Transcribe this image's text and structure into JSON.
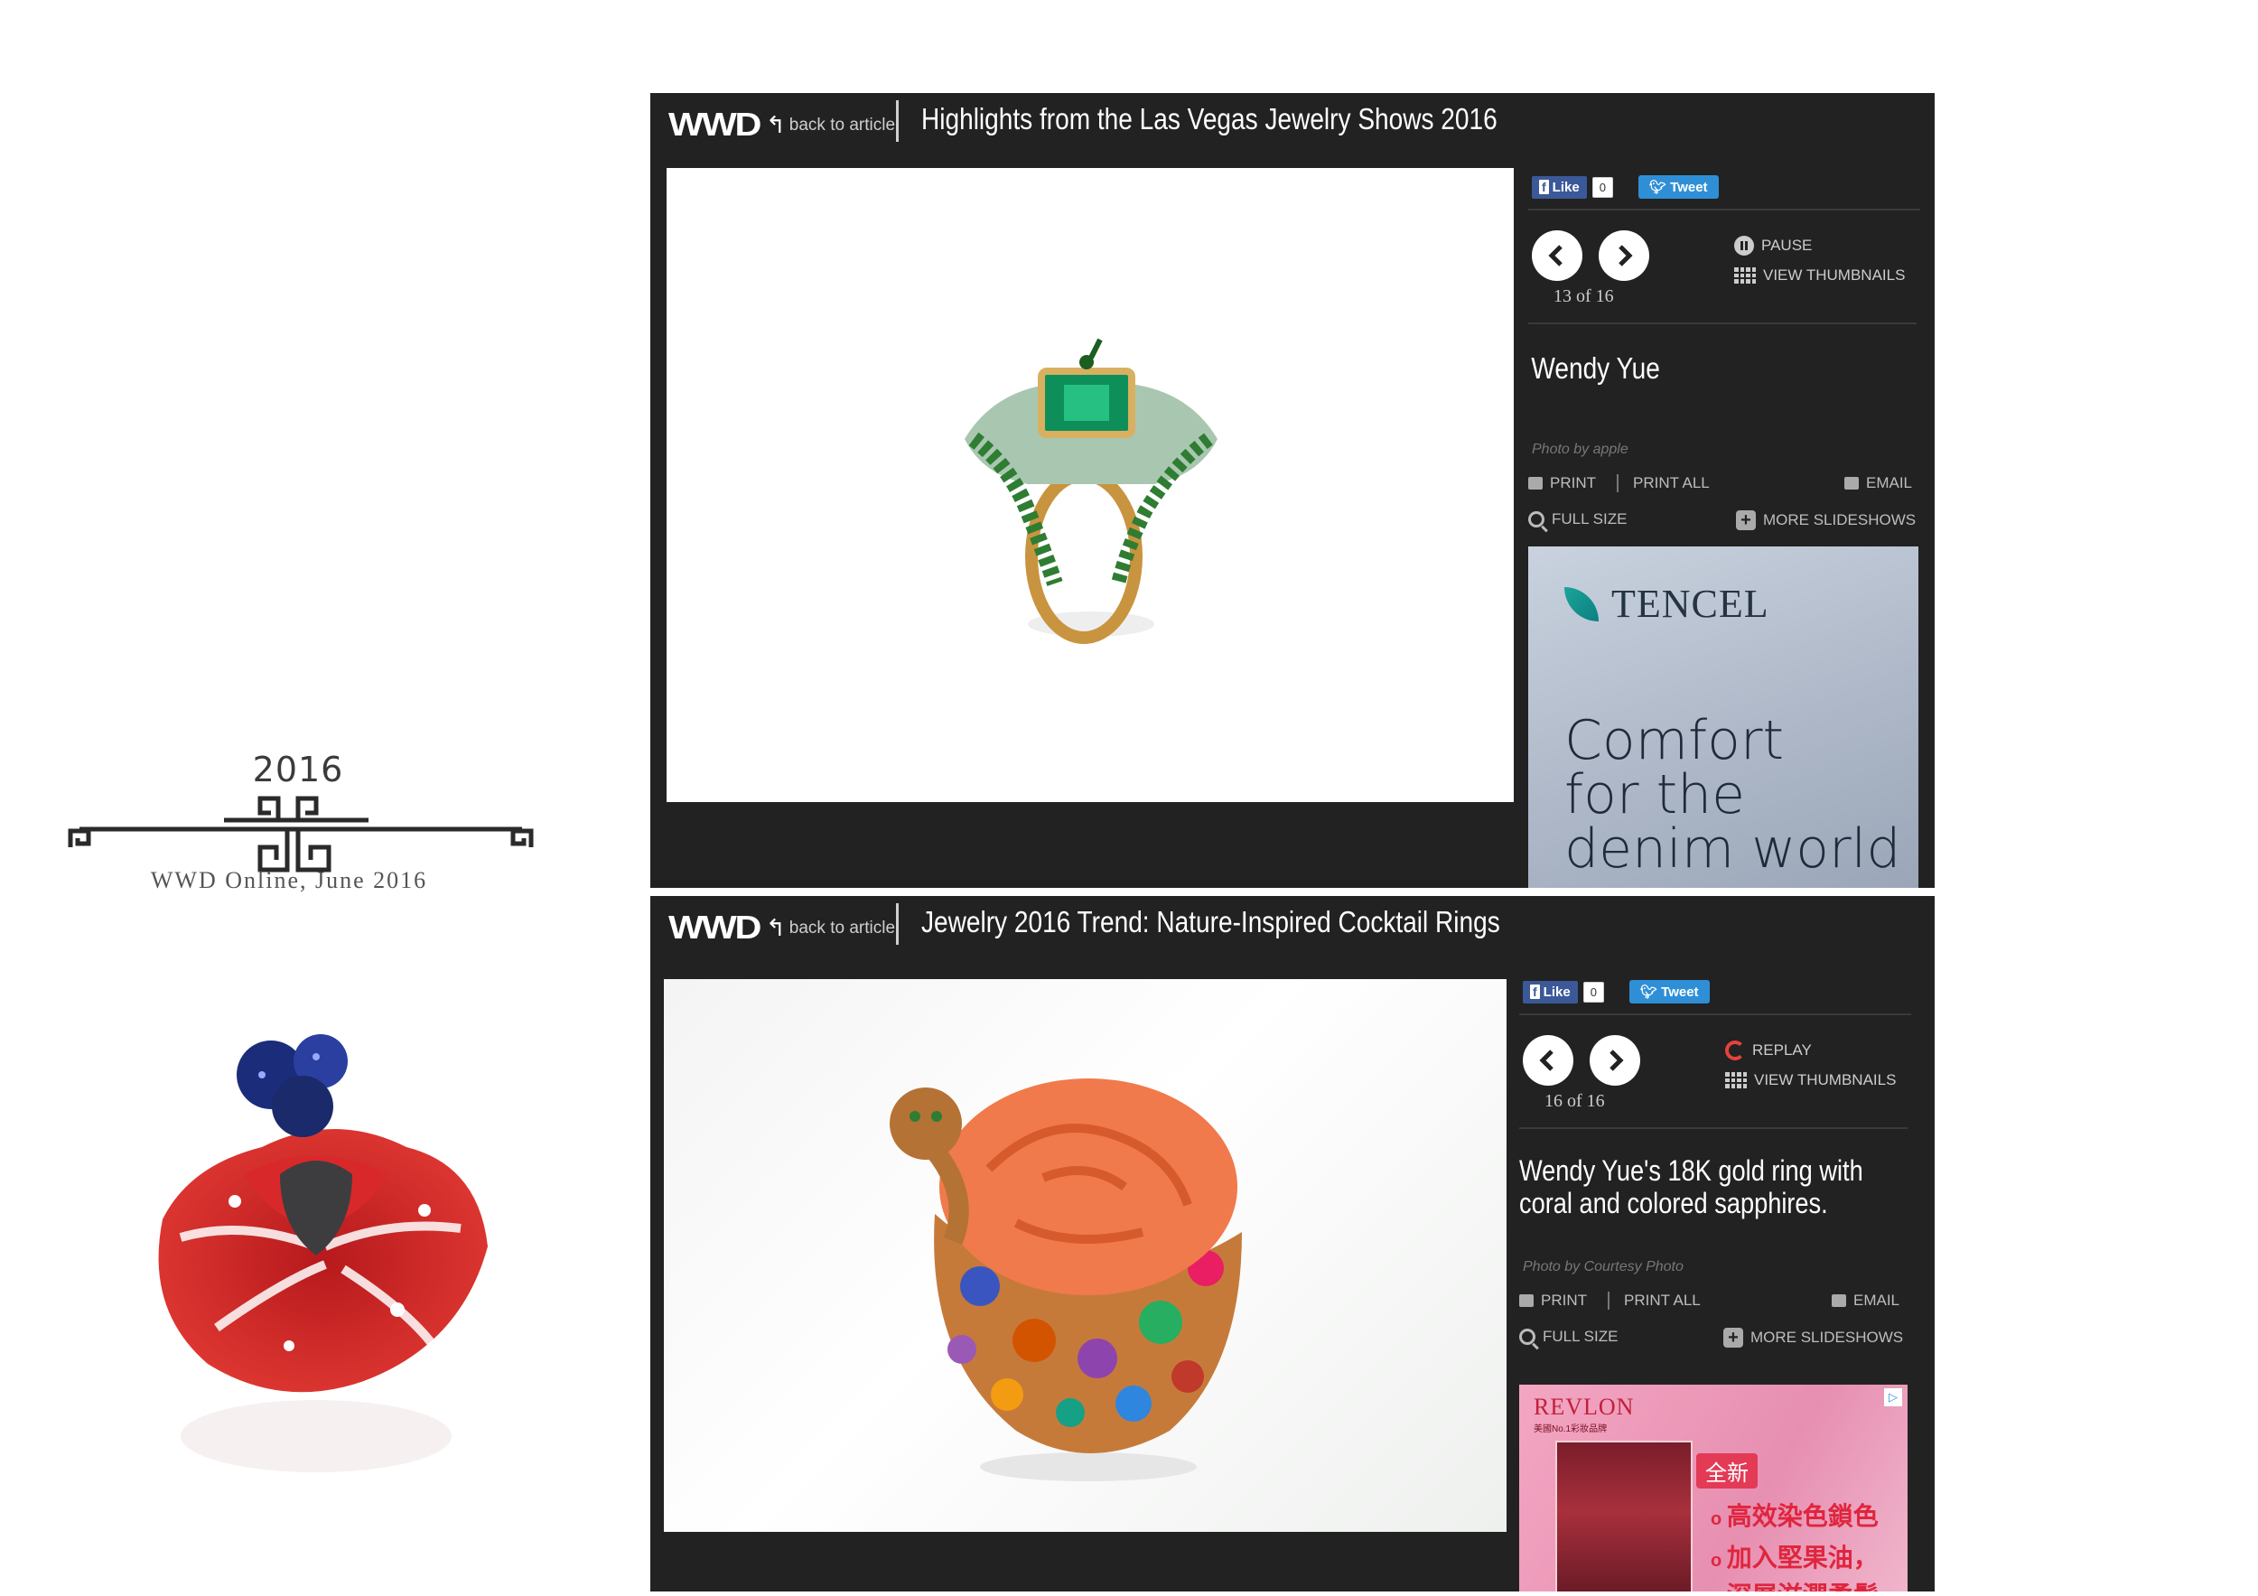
{
  "page": {
    "year": "2016",
    "caption": "WWD Online, June 2016"
  },
  "panels": [
    {
      "logo": "WWD",
      "back_label": "back to article",
      "title": "Highlights from the Las Vegas Jewelry Shows 2016",
      "like_label": "Like",
      "like_count": "0",
      "tweet_label": "Tweet",
      "counter": "13 of 16",
      "control_primary": "PAUSE",
      "control_thumbnails": "VIEW THUMBNAILS",
      "description": "Wendy Yue",
      "credit": "Photo by apple",
      "print_label": "PRINT",
      "print_all_label": "PRINT ALL",
      "email_label": "EMAIL",
      "full_size_label": "FULL SIZE",
      "more_label": "MORE SLIDESHOWS",
      "ad": {
        "brand": "TENCEL",
        "tagline_1": "Comfort",
        "tagline_2": "for the",
        "tagline_3": "denim world"
      }
    },
    {
      "logo": "WWD",
      "back_label": "back to article",
      "title": "Jewelry 2016 Trend: Nature-Inspired Cocktail Rings",
      "like_label": "Like",
      "like_count": "0",
      "tweet_label": "Tweet",
      "counter": "16 of 16",
      "control_primary": "REPLAY",
      "control_thumbnails": "VIEW THUMBNAILS",
      "description": "Wendy Yue's 18K gold ring with coral and colored sapphires.",
      "credit": "Photo by Courtesy Photo",
      "print_label": "PRINT",
      "print_all_label": "PRINT ALL",
      "email_label": "EMAIL",
      "full_size_label": "FULL SIZE",
      "more_label": "MORE SLIDESHOWS",
      "ad": {
        "brand": "REVLON",
        "sub": "美國No.1彩妝品牌",
        "new_badge": "全新",
        "line_1": "高效染色鎖色",
        "line_2": "加入堅果油，",
        "line_3": "深層滋潤柔髮",
        "ad_choice": "▷"
      }
    }
  ],
  "colors": {
    "panel_bg": "#222222",
    "facebook": "#3b5998",
    "twitter": "#2f8fd6",
    "replay_red": "#e8413c"
  }
}
